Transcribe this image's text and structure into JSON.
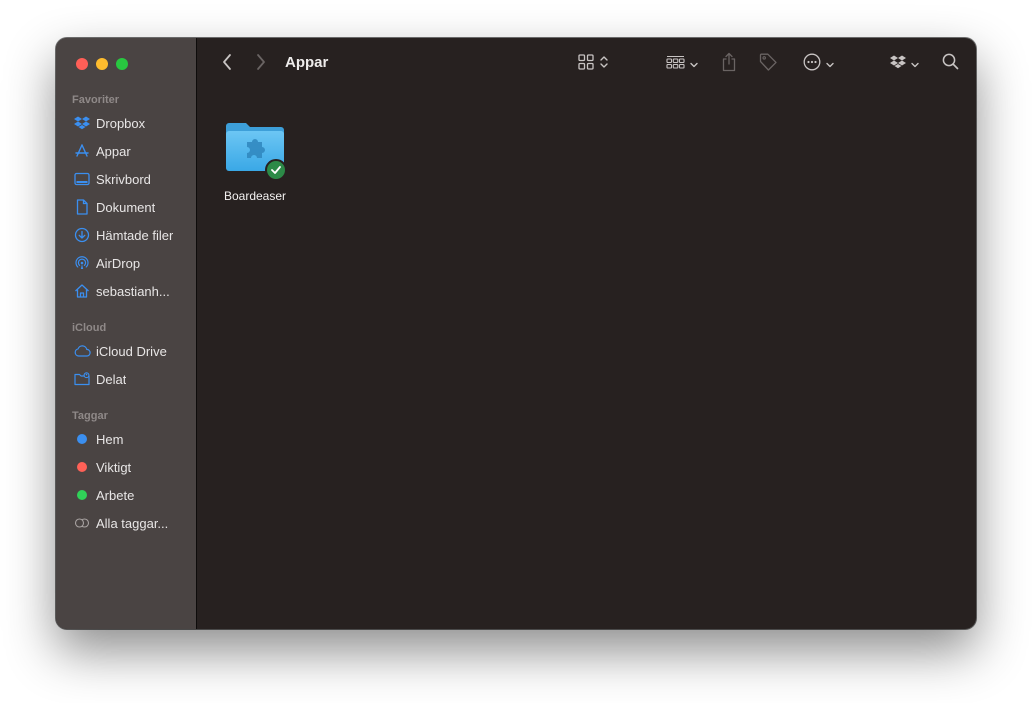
{
  "window": {
    "title": "Appar"
  },
  "sidebar": {
    "favorites_title": "Favoriter",
    "favorites": [
      {
        "label": "Dropbox",
        "icon": "dropbox-icon"
      },
      {
        "label": "Appar",
        "icon": "apps-icon"
      },
      {
        "label": "Skrivbord",
        "icon": "desktop-icon"
      },
      {
        "label": "Dokument",
        "icon": "document-icon"
      },
      {
        "label": "Hämtade filer",
        "icon": "download-icon"
      },
      {
        "label": "AirDrop",
        "icon": "airdrop-icon"
      },
      {
        "label": "sebastianh...",
        "icon": "home-icon"
      }
    ],
    "icloud_title": "iCloud",
    "icloud": [
      {
        "label": "iCloud Drive",
        "icon": "cloud-icon"
      },
      {
        "label": "Delat",
        "icon": "shared-folder-icon"
      }
    ],
    "tags_title": "Taggar",
    "tags": [
      {
        "label": "Hem",
        "color": "#3b8ff0"
      },
      {
        "label": "Viktigt",
        "color": "#ff6157"
      },
      {
        "label": "Arbete",
        "color": "#30d158"
      },
      {
        "label": "Alla taggar...",
        "color": "outline"
      }
    ]
  },
  "toolbar": {
    "back_icon": "chevron-left-icon",
    "forward_icon": "chevron-right-icon",
    "view_icon": "icon-grid-view-icon",
    "group_icon": "group-by-icon",
    "share_icon": "share-icon",
    "tag_icon": "tag-icon",
    "more_icon": "ellipsis-circle-icon",
    "dropbox_icon": "dropbox-icon",
    "search_icon": "search-icon"
  },
  "files": [
    {
      "name": "Boardeaser",
      "icon": "app-folder-icon",
      "status": "synced-check-icon"
    }
  ],
  "colors": {
    "accent": "#3b8ff0",
    "folder": "#4cb4ee",
    "sync_badge": "#2c8a47"
  }
}
